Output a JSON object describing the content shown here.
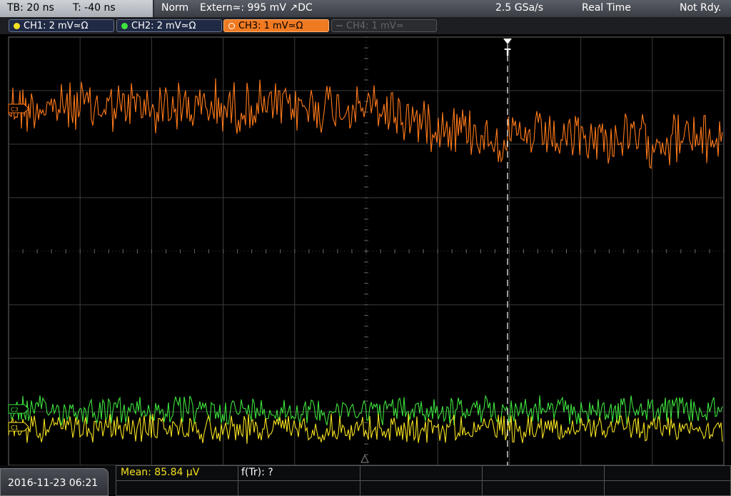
{
  "status": {
    "timebase": "TB: 20 ns",
    "trigger_offset": "T: -40 ns",
    "trigger_mode": "Norm",
    "trigger_source": "Extern≃: 995 mV ↗DC",
    "sample_rate": "2.5 GSa/s",
    "acq_mode": "Real Time",
    "state": "Not Rdy."
  },
  "channels": [
    {
      "label": "CH1: 2 mV≃Ω",
      "color": "#f4e020"
    },
    {
      "label": "CH2: 2 mV≃Ω",
      "color": "#3ee23e"
    },
    {
      "label": "CH3: 1 mV≃Ω",
      "color": "#ff7a1a"
    },
    {
      "label": "CH4: 1 mV≃",
      "color": "#666666"
    }
  ],
  "markers": {
    "ch1": "C1",
    "ch2": "C2",
    "ch3": "C3",
    "trigger": "T"
  },
  "footer": {
    "datetime": "2016-11-23 06:21",
    "mean": "Mean: 85.84 µV",
    "ftr": "f(Tr): ?"
  },
  "colors": {
    "grid": "#4a4a4a",
    "ch1": "#f4e020",
    "ch2": "#3ee23e",
    "ch3": "#ff7a1a",
    "trigger": "#ffffff"
  }
}
